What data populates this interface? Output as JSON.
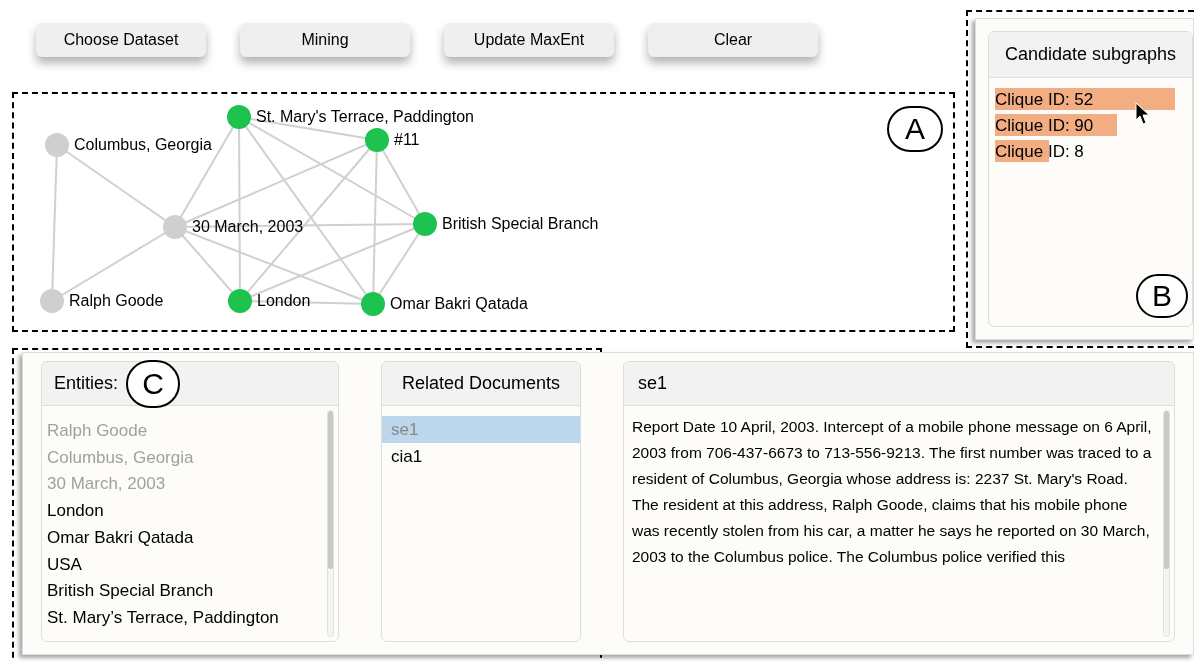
{
  "toolbar": {
    "buttons": [
      "Choose Dataset",
      "Mining",
      "Update MaxEnt",
      "Clear"
    ]
  },
  "graph": {
    "annotation": "A",
    "nodes": [
      {
        "label": "St. Mary's Terrace, Paddington",
        "active": true
      },
      {
        "label": "#11",
        "active": true
      },
      {
        "label": "Columbus, Georgia",
        "active": false
      },
      {
        "label": "30 March, 2003",
        "active": false
      },
      {
        "label": "British Special Branch",
        "active": true
      },
      {
        "label": "Ralph Goode",
        "active": false
      },
      {
        "label": "London",
        "active": true
      },
      {
        "label": "Omar Bakri Qatada",
        "active": true
      }
    ]
  },
  "candidates": {
    "title": "Candidate subgraphs",
    "annotation": "B",
    "items": [
      {
        "label": "Clique ID: 52",
        "level": 1.0
      },
      {
        "label": "Clique ID: 90",
        "level": 0.68
      },
      {
        "label": "Clique ID: 8",
        "level": 0.3
      }
    ]
  },
  "entities": {
    "title": "Entities:",
    "annotation": "C",
    "items": [
      {
        "label": "Ralph Goode",
        "dimmed": true
      },
      {
        "label": "Columbus,  Georgia",
        "dimmed": true
      },
      {
        "label": "30 March, 2003",
        "dimmed": true
      },
      {
        "label": "London",
        "dimmed": false
      },
      {
        "label": "Omar Bakri Qatada",
        "dimmed": false
      },
      {
        "label": "USA",
        "dimmed": false
      },
      {
        "label": "British Special Branch",
        "dimmed": false
      },
      {
        "label": "St. Mary’s Terrace, Paddington",
        "dimmed": false
      }
    ]
  },
  "documents": {
    "title": "Related Documents",
    "items": [
      {
        "label": "se1",
        "selected": true
      },
      {
        "label": "cia1",
        "selected": false
      }
    ]
  },
  "document_view": {
    "title": "se1",
    "text": "Report Date 10 April, 2003. Intercept of a mobile phone message on 6 April, 2003 from 706-437-6673 to 713-556-9213. The first number was traced to a resident of Columbus, Georgia whose address is: 2237 St. Mary's Road. The resident at this address, Ralph Goode, claims that his mobile phone was recently stolen from his car, a matter he says he reported on 30 March, 2003 to the Columbus police. The Columbus police verified this"
  }
}
